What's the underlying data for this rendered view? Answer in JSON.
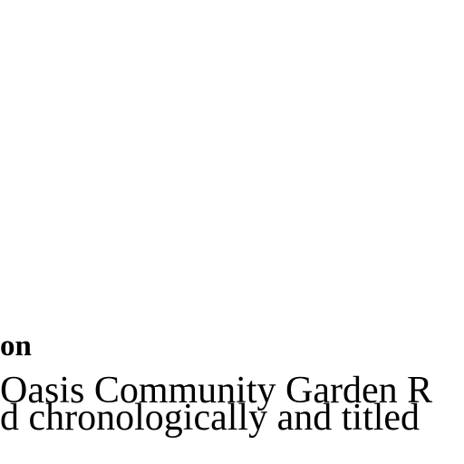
{
  "document": {
    "heading_fragment": "on",
    "lines": [
      "Oasis Community Garden R",
      "d chronologically and titled"
    ]
  }
}
